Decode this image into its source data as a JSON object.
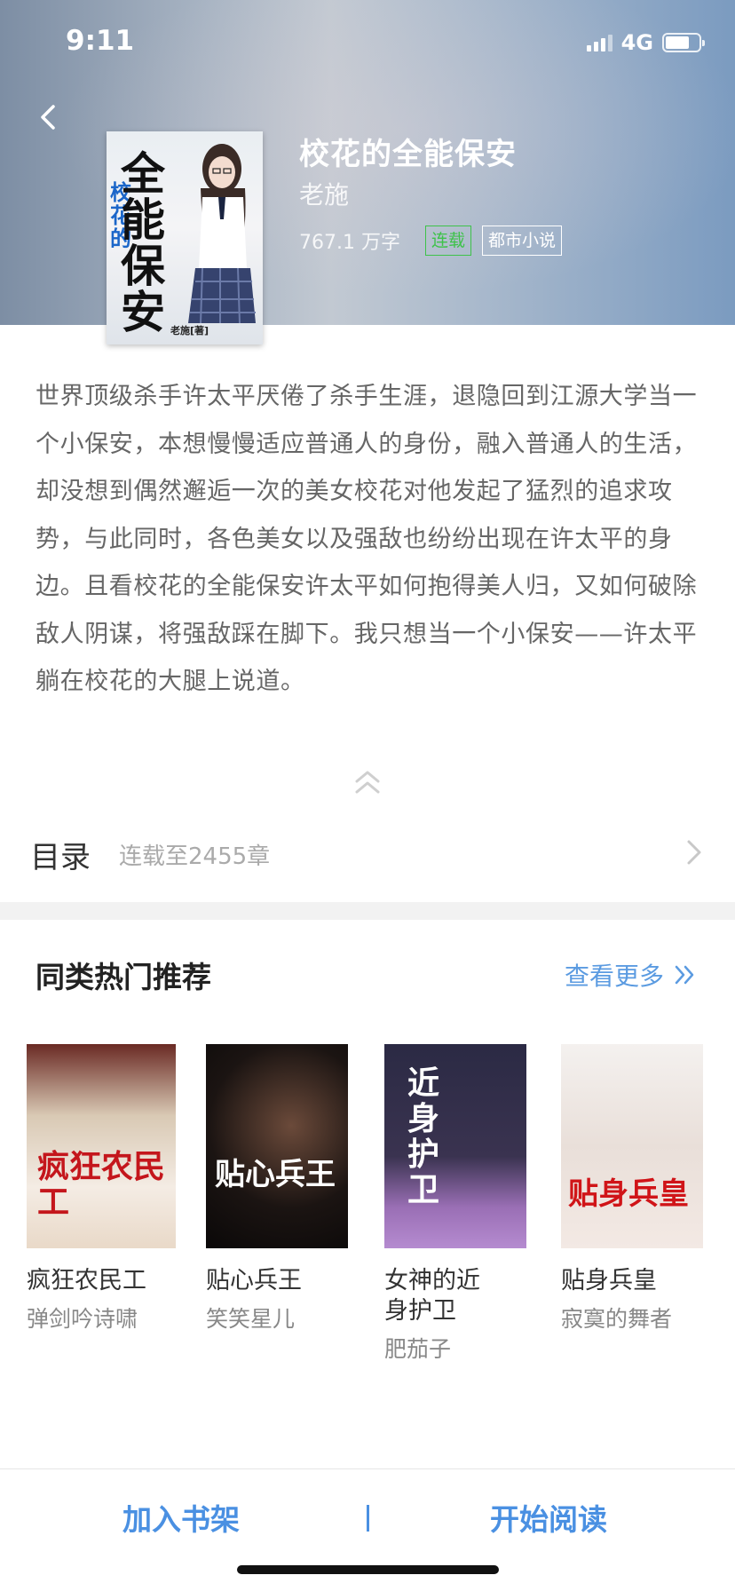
{
  "status_bar": {
    "time": "9:11",
    "network": "4G"
  },
  "book": {
    "title": "校花的全能保安",
    "author": "老施",
    "word_count": "767.1 万字",
    "status_tag": "连载",
    "genre_tag": "都市小说",
    "cover": {
      "title_big": "全能保安",
      "title_small": "校花的",
      "author_mark": "老施[著]"
    }
  },
  "synopsis": "世界顶级杀手许太平厌倦了杀手生涯，退隐回到江源大学当一个小保安，本想慢慢适应普通人的身份，融入普通人的生活，却没想到偶然邂逅一次的美女校花对他发起了猛烈的追求攻势，与此同时，各色美女以及强敌也纷纷出现在许太平的身边。且看校花的全能保安许太平如何抱得美人归，又如何破除敌人阴谋，将强敌踩在脚下。我只想当一个小保安——许太平躺在校花的大腿上说道。",
  "toc": {
    "label": "目录",
    "progress": "连载至2455章"
  },
  "recommend": {
    "title": "同类热门推荐",
    "more_label": "查看更多",
    "books": [
      {
        "name": "疯狂农民工",
        "author": "弹剑吟诗啸",
        "cover_text": "疯狂农民工"
      },
      {
        "name": "贴心兵王",
        "author": "笑笑星儿",
        "cover_text": "贴心兵王"
      },
      {
        "name": "女神的近身护卫",
        "author": "肥茄子",
        "cover_text": "近身护卫"
      },
      {
        "name": "贴身兵皇",
        "author": "寂寞的舞者",
        "cover_text": "贴身兵皇"
      }
    ]
  },
  "bottom_bar": {
    "add_shelf": "加入书架",
    "start_read": "开始阅读"
  },
  "colors": {
    "accent": "#4a90e2",
    "serial_tag": "#3ec24a",
    "text_body": "#666666"
  }
}
